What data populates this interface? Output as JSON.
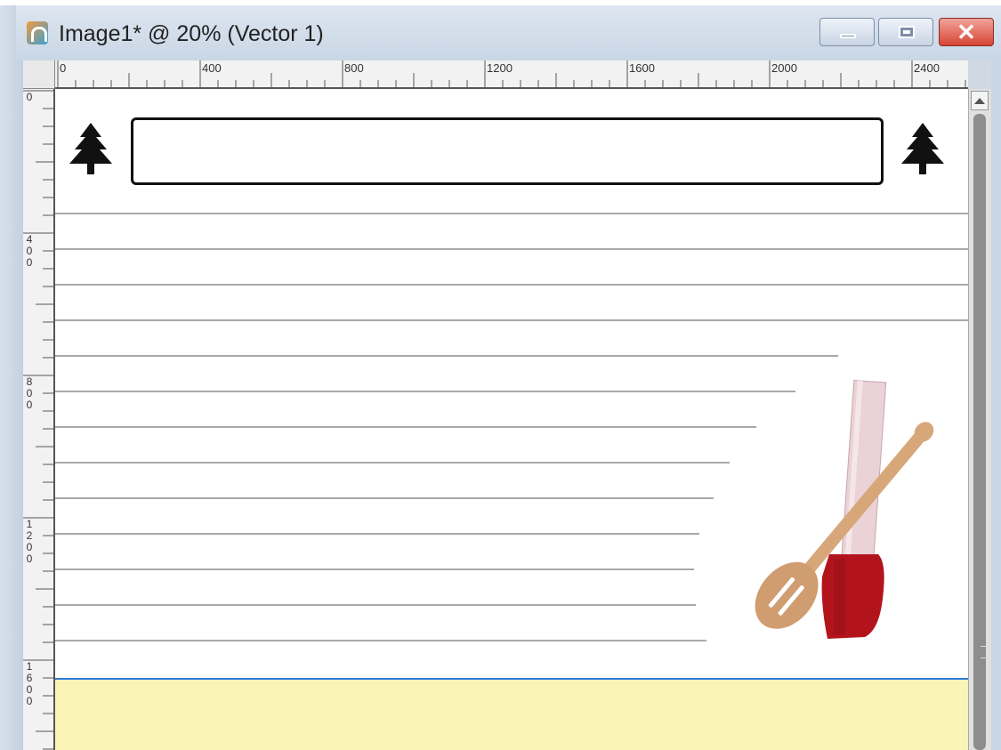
{
  "window": {
    "title": "Image1* @  20% (Vector 1)",
    "controls": {
      "minimize": "minimize",
      "maximize": "maximize",
      "close": "✕"
    }
  },
  "rulers": {
    "horizontal": [
      "0",
      "400",
      "800",
      "1200",
      "1600",
      "2000",
      "2400"
    ],
    "vertical": [
      "0",
      "4\n0\n0",
      "8\n0\n0",
      "1\n2\n0\n0",
      "1\n6\n0\n0"
    ]
  },
  "colors": {
    "footer_band": "#faf4b6",
    "selection_line": "#2f7bd9",
    "rule_line": "#a9a9a9",
    "spatula_red": "#b3141c",
    "spoon_wood": "#d7a77a"
  },
  "icons": {
    "left_tree": "tree-icon",
    "right_tree": "tree-icon",
    "utensils": "wooden-spoon-and-spatula"
  }
}
